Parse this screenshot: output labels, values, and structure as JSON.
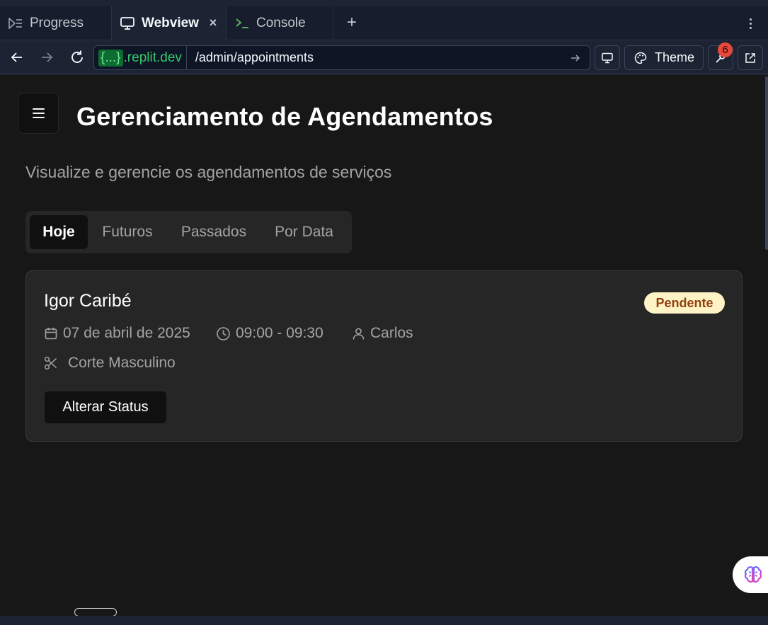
{
  "tabs": [
    {
      "label": "Progress",
      "active": false,
      "icon": "progress-icon"
    },
    {
      "label": "Webview",
      "active": true,
      "icon": "monitor-icon"
    },
    {
      "label": "Console",
      "active": false,
      "icon": "terminal-icon"
    }
  ],
  "tab_close": "×",
  "tab_add": "+",
  "address": {
    "brace": "{...}",
    "domain": ".replit.dev",
    "path": "/admin/appointments"
  },
  "toolbar": {
    "theme_label": "Theme",
    "devtools_badge": "6"
  },
  "page": {
    "title": "Gerenciamento de Agendamentos",
    "subtitle": "Visualize e gerencie os agendamentos de serviços",
    "tabs": [
      "Hoje",
      "Futuros",
      "Passados",
      "Por Data"
    ],
    "active_tab": "Hoje"
  },
  "appointment": {
    "client": "Igor Caribé",
    "status": "Pendente",
    "date": "07 de abril de 2025",
    "time": "09:00 - 09:30",
    "professional": "Carlos",
    "service": "Corte Masculino",
    "action_label": "Alterar Status"
  },
  "colors": {
    "status_bg": "#fef3c7",
    "status_text": "#92400e",
    "domain_green": "#36c96d",
    "badge_red": "#e8483b"
  }
}
